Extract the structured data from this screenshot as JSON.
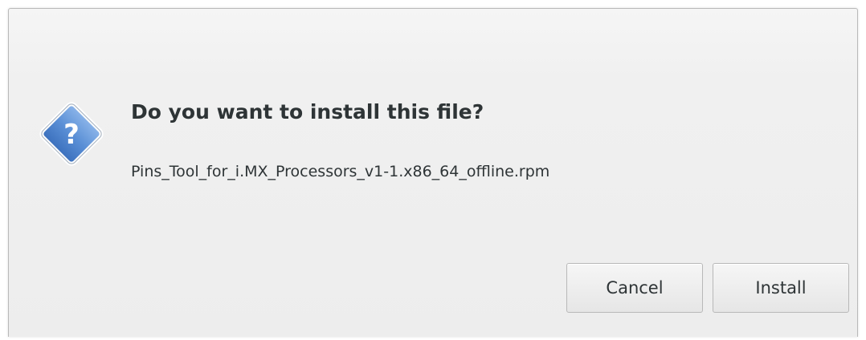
{
  "dialog": {
    "title": "Do you want to install this file?",
    "filename": "Pins_Tool_for_i.MX_Processors_v1-1.x86_64_offline.rpm",
    "icon": "question-diamond-icon",
    "buttons": {
      "cancel_label": "Cancel",
      "install_label": "Install"
    }
  },
  "colors": {
    "icon_fill": "#5a8fd6",
    "icon_border": "#ffffff",
    "text": "#2e3436",
    "dialog_bg": "#f0f0f0"
  }
}
